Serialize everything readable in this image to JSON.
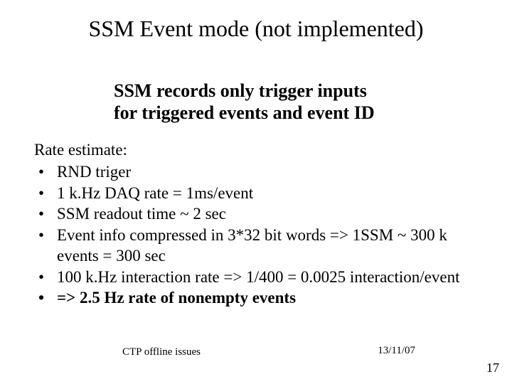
{
  "title": "SSM Event mode (not implemented)",
  "subtitle_line1": "SSM records only trigger inputs",
  "subtitle_line2": "for triggered events and event ID",
  "body": {
    "lead": "Rate estimate:",
    "items": [
      {
        "text": "RND triger",
        "bold": false
      },
      {
        "text": "1 k.Hz DAQ rate = 1ms/event",
        "bold": false
      },
      {
        "text": "SSM readout time ~ 2 sec",
        "bold": false
      },
      {
        "text": "Event info compressed in 3*32 bit words => 1SSM ~ 300 k events = 300 sec",
        "bold": false
      },
      {
        "text": "100 k.Hz interaction rate => 1/400 = 0.0025 interaction/event",
        "bold": false
      },
      {
        "text": "=> 2.5 Hz rate of nonempty events",
        "bold": true
      }
    ]
  },
  "footer": {
    "left": "CTP offline issues",
    "right": "13/11/07",
    "page": "17"
  }
}
